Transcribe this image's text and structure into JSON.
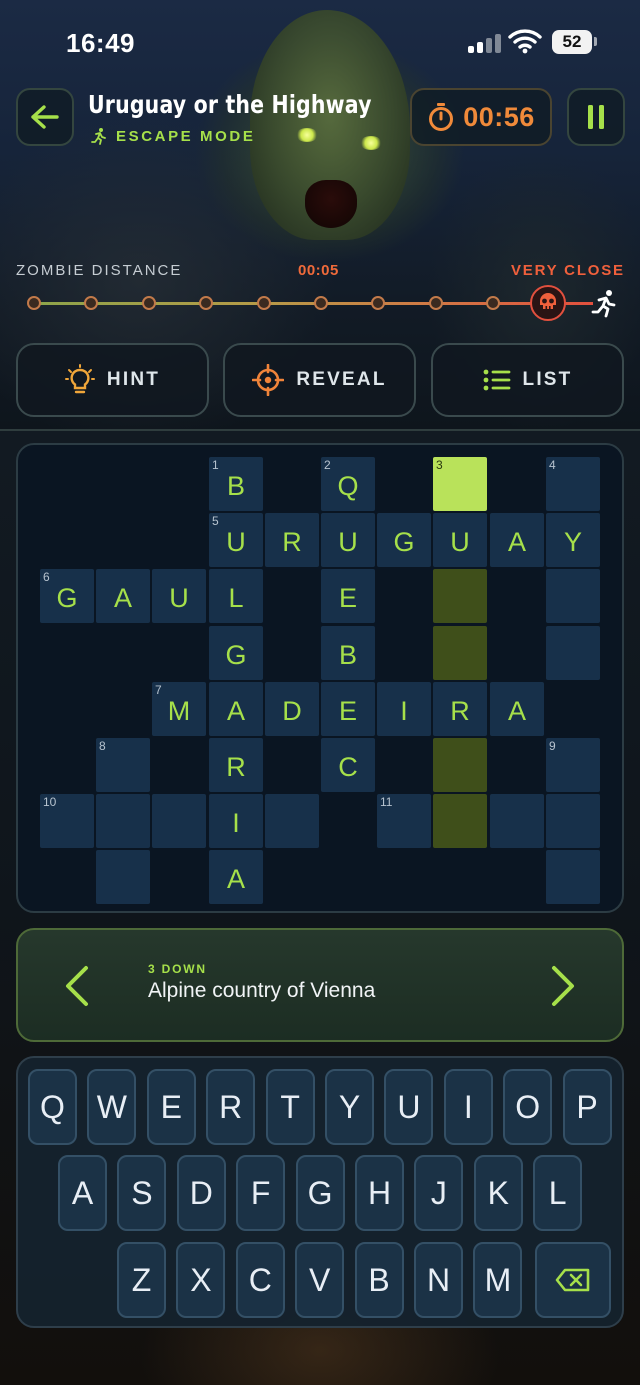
{
  "status_bar": {
    "time": "16:49",
    "battery": "52"
  },
  "header": {
    "title": "Uruguay or the Highway",
    "mode_label": "ESCAPE MODE",
    "timer": "00:56"
  },
  "distance": {
    "label": "ZOMBIE DISTANCE",
    "time": "00:05",
    "status": "VERY CLOSE",
    "progress_steps_total": 10,
    "progress_steps_closed": 9
  },
  "actions": [
    {
      "label": "HINT",
      "icon": "lightbulb-icon"
    },
    {
      "label": "REVEAL",
      "icon": "crosshair-icon"
    },
    {
      "label": "LIST",
      "icon": "list-icon"
    }
  ],
  "crossword": {
    "cells": [
      {
        "r": 0,
        "c": 3,
        "num": "1",
        "letter": "B"
      },
      {
        "r": 0,
        "c": 5,
        "num": "2",
        "letter": "Q"
      },
      {
        "r": 0,
        "c": 7,
        "num": "3",
        "letter": "",
        "state": "selected"
      },
      {
        "r": 0,
        "c": 9,
        "num": "4",
        "letter": ""
      },
      {
        "r": 1,
        "c": 3,
        "num": "5",
        "letter": "U"
      },
      {
        "r": 1,
        "c": 4,
        "letter": "R"
      },
      {
        "r": 1,
        "c": 5,
        "letter": "U"
      },
      {
        "r": 1,
        "c": 6,
        "letter": "G"
      },
      {
        "r": 1,
        "c": 7,
        "letter": "U"
      },
      {
        "r": 1,
        "c": 8,
        "letter": "A"
      },
      {
        "r": 1,
        "c": 9,
        "letter": "Y"
      },
      {
        "r": 2,
        "c": 0,
        "num": "6",
        "letter": "G"
      },
      {
        "r": 2,
        "c": 1,
        "letter": "A"
      },
      {
        "r": 2,
        "c": 2,
        "letter": "U"
      },
      {
        "r": 2,
        "c": 3,
        "letter": "L"
      },
      {
        "r": 2,
        "c": 5,
        "letter": "E"
      },
      {
        "r": 2,
        "c": 7,
        "letter": "",
        "state": "active"
      },
      {
        "r": 2,
        "c": 9,
        "letter": ""
      },
      {
        "r": 3,
        "c": 3,
        "letter": "G"
      },
      {
        "r": 3,
        "c": 5,
        "letter": "B"
      },
      {
        "r": 3,
        "c": 7,
        "letter": "",
        "state": "active"
      },
      {
        "r": 3,
        "c": 9,
        "letter": ""
      },
      {
        "r": 4,
        "c": 2,
        "num": "7",
        "letter": "M"
      },
      {
        "r": 4,
        "c": 3,
        "letter": "A"
      },
      {
        "r": 4,
        "c": 4,
        "letter": "D"
      },
      {
        "r": 4,
        "c": 5,
        "letter": "E"
      },
      {
        "r": 4,
        "c": 6,
        "letter": "I"
      },
      {
        "r": 4,
        "c": 7,
        "letter": "R"
      },
      {
        "r": 4,
        "c": 8,
        "letter": "A"
      },
      {
        "r": 5,
        "c": 1,
        "num": "8",
        "letter": ""
      },
      {
        "r": 5,
        "c": 3,
        "letter": "R"
      },
      {
        "r": 5,
        "c": 5,
        "letter": "C"
      },
      {
        "r": 5,
        "c": 7,
        "letter": "",
        "state": "active"
      },
      {
        "r": 5,
        "c": 9,
        "num": "9",
        "letter": ""
      },
      {
        "r": 6,
        "c": 0,
        "num": "10",
        "letter": ""
      },
      {
        "r": 6,
        "c": 1,
        "letter": ""
      },
      {
        "r": 6,
        "c": 2,
        "letter": ""
      },
      {
        "r": 6,
        "c": 3,
        "letter": "I"
      },
      {
        "r": 6,
        "c": 4,
        "letter": ""
      },
      {
        "r": 6,
        "c": 6,
        "num": "11",
        "letter": ""
      },
      {
        "r": 6,
        "c": 7,
        "letter": "",
        "state": "active"
      },
      {
        "r": 6,
        "c": 8,
        "letter": ""
      },
      {
        "r": 6,
        "c": 9,
        "letter": ""
      },
      {
        "r": 7,
        "c": 1,
        "letter": ""
      },
      {
        "r": 7,
        "c": 3,
        "letter": "A"
      },
      {
        "r": 7,
        "c": 9,
        "letter": ""
      }
    ]
  },
  "clue": {
    "direction": "3 DOWN",
    "text": "Alpine country of Vienna"
  },
  "keyboard": {
    "row1": [
      "Q",
      "W",
      "E",
      "R",
      "T",
      "Y",
      "U",
      "I",
      "O",
      "P"
    ],
    "row2": [
      "A",
      "S",
      "D",
      "F",
      "G",
      "H",
      "J",
      "K",
      "L"
    ],
    "row3": [
      "Z",
      "X",
      "C",
      "V",
      "B",
      "N",
      "M"
    ],
    "delete_icon": "backspace-icon"
  },
  "colors": {
    "accent_green": "#a6e04a",
    "timer_orange": "#f08a3a",
    "danger_red": "#f0603c"
  }
}
